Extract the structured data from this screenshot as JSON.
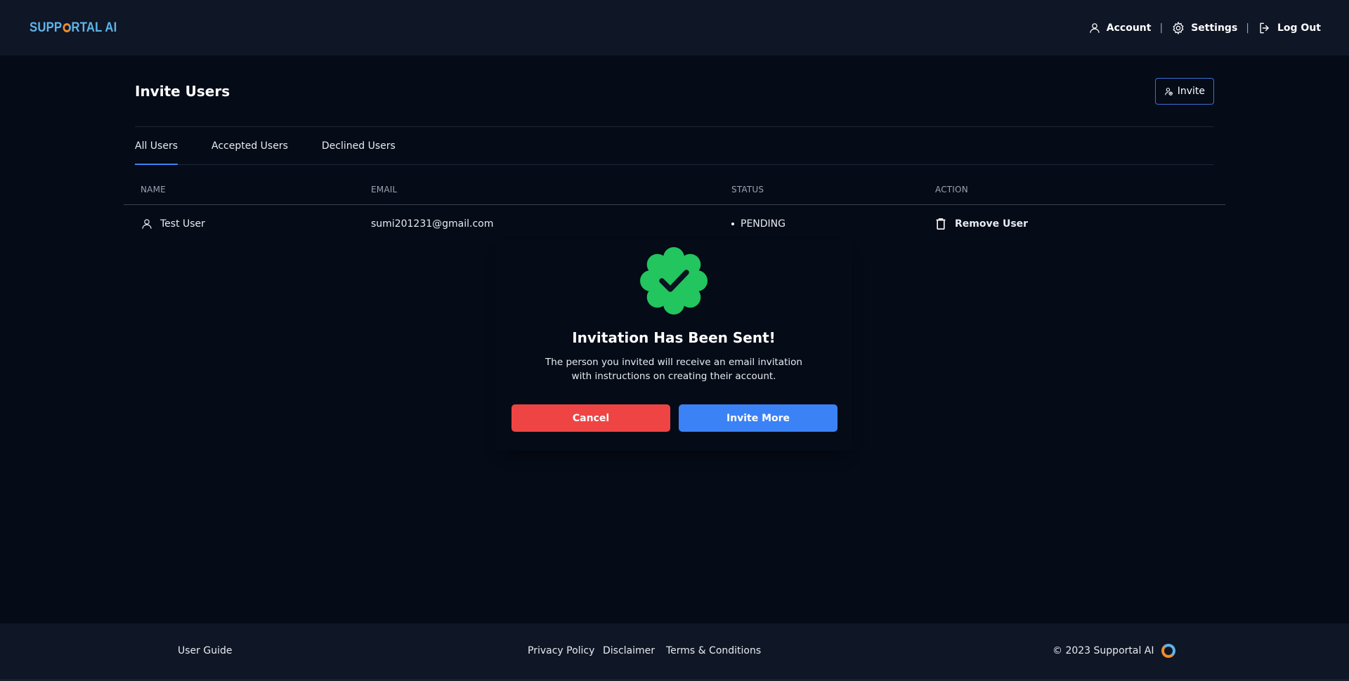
{
  "app": {
    "logo_left": "SUPP",
    "logo_right": "RTAL AI"
  },
  "header": {
    "account_label": "Account",
    "settings_label": "Settings",
    "logout_label": "Log Out",
    "separator": "|"
  },
  "page": {
    "title": "Invite Users",
    "invite_label": "Invite"
  },
  "tabs": [
    {
      "label": "All Users",
      "active": true
    },
    {
      "label": "Accepted Users",
      "active": false
    },
    {
      "label": "Declined Users",
      "active": false
    }
  ],
  "table": {
    "headers": {
      "name": "NAME",
      "email": "EMAIL",
      "status": "STATUS",
      "action": "ACTION"
    },
    "rows": [
      {
        "name": "Test User",
        "email": "sumi201231@gmail.com",
        "status": "PENDING",
        "action": "Remove User"
      }
    ]
  },
  "dialog": {
    "title": "Invitation Has Been Sent!",
    "message": "The person you invited will receive an email invitation with instructions on creating their account.",
    "cancel_label": "Cancel",
    "invite_more_label": "Invite More"
  },
  "footer": {
    "user_guide": "User Guide",
    "privacy": "Privacy Policy",
    "disclaimer": "Disclaimer",
    "terms": "Terms & Conditions",
    "copyright": "© 2023 Supportal AI"
  },
  "colors": {
    "background": "#050b17",
    "header_bg": "#0f1626",
    "accent": "#3b82f6",
    "danger": "#ef4444",
    "success": "#22c55e",
    "logo": "#5fb4e8"
  },
  "icons": {
    "account": "user-icon",
    "settings": "gear-icon",
    "logout": "logout-icon",
    "invite": "user-plus-icon",
    "row_user": "user-icon",
    "remove": "trash-icon",
    "success": "check-badge-icon"
  }
}
